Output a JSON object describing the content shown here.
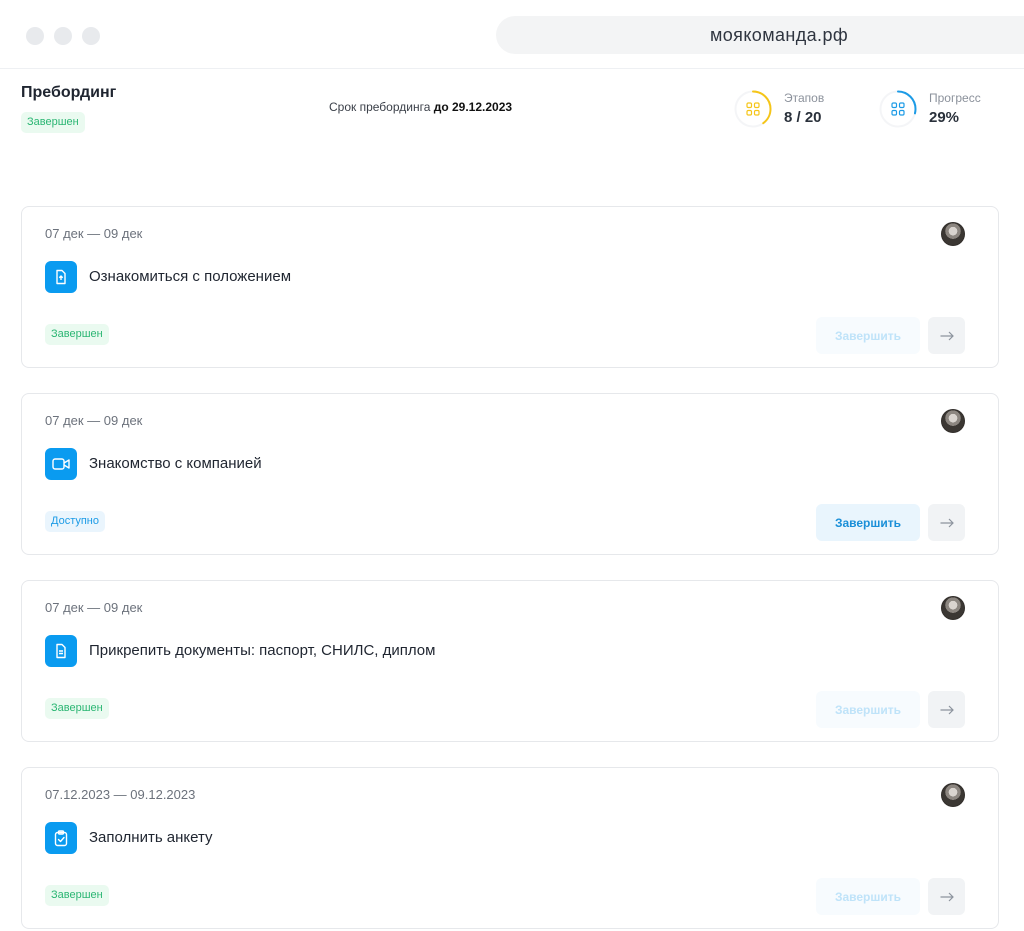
{
  "browser": {
    "url": "моякоманда.рф"
  },
  "header": {
    "title": "Пребординг",
    "status": "Завершен",
    "deadline_label": "Срок пребординга",
    "deadline_value": "до 29.12.2023",
    "stages": {
      "label": "Этапов",
      "value": "8 / 20",
      "fraction": 0.4,
      "color": "#f5c518"
    },
    "progress": {
      "label": "Прогресс",
      "value": "29%",
      "fraction": 0.29,
      "color": "#1c9be6"
    }
  },
  "cards": [
    {
      "date": "07 дек — 09 дек",
      "icon": "document-upload-icon",
      "title": "Ознакомиться с положением",
      "status": "Завершен",
      "status_type": "done",
      "button": "Завершить",
      "button_state": "disabled"
    },
    {
      "date": "07 дек — 09 дек",
      "icon": "video-camera-icon",
      "title": "Знакомство с компанией",
      "status": "Доступно",
      "status_type": "available",
      "button": "Завершить",
      "button_state": "active"
    },
    {
      "date": "07 дек — 09 дек",
      "icon": "document-text-icon",
      "title": "Прикрепить документы: паспорт, СНИЛС, диплом",
      "status": "Завершен",
      "status_type": "done",
      "button": "Завершить",
      "button_state": "disabled"
    },
    {
      "date": "07.12.2023 — 09.12.2023",
      "icon": "clipboard-check-icon",
      "title": "Заполнить анкету",
      "status": "Завершен",
      "status_type": "done",
      "button": "Завершить",
      "button_state": "disabled"
    }
  ]
}
